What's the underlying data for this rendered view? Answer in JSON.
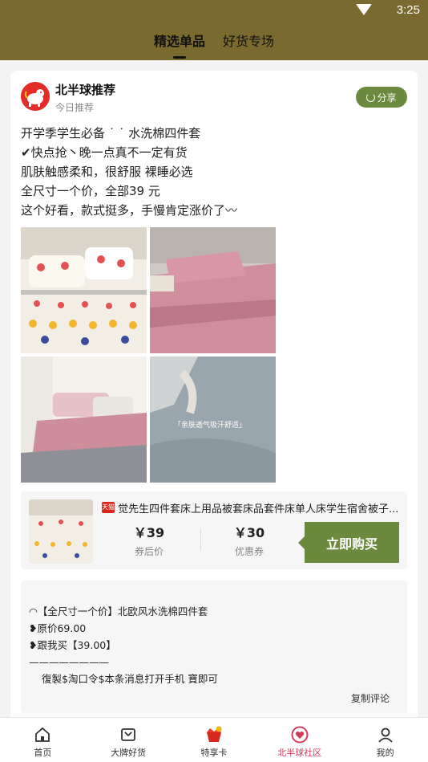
{
  "status": {
    "time": "3:25"
  },
  "tabs": [
    {
      "label": "精选单品",
      "active": true
    },
    {
      "label": "好货专场",
      "active": false
    }
  ],
  "post": {
    "author": "北半球推荐",
    "subtitle": "今日推荐",
    "share_label": "分享",
    "lines": [
      "开学季学生必备 ˙ ˙ 水洗棉四件套",
      "✔快点抢丶晚一点真不一定有货",
      "肌肤触感柔和，很舒服    裸睡必选",
      "全尺寸一个价，全部39    元",
      "这个好看，款式挺多，手慢肯定涨价了〰"
    ],
    "photo_caption": "「亲肤透气吸汗舒适」"
  },
  "product": {
    "title": "觉先生四件套床上用品被套床品套件床单人床学生宿舍被子...",
    "shop_badge": "天猫",
    "price": "￥39",
    "price_label": "券后价",
    "coupon": "￥30",
    "coupon_label": "优惠券",
    "buy_label": "立即购买"
  },
  "comment": {
    "lines": [
      "◠【全尺寸一个价】北欧风水洗棉四件套",
      "❥原价69.00",
      "❥跟我买【39.00】",
      "————————",
      "復製$淘口令$本条消息打开手机  寶即可"
    ],
    "copy_label": "复制评论"
  },
  "nav": [
    {
      "label": "首页",
      "icon": "home-icon"
    },
    {
      "label": "大牌好货",
      "icon": "brand-goods-icon"
    },
    {
      "label": "特享卡",
      "icon": "vip-card-icon"
    },
    {
      "label": "北半球社区",
      "icon": "community-icon",
      "active": true
    },
    {
      "label": "我的",
      "icon": "profile-icon"
    }
  ],
  "colors": {
    "header": "#7b6a2f",
    "accent_green": "#6b8a3e",
    "active_nav": "#d23b58"
  }
}
